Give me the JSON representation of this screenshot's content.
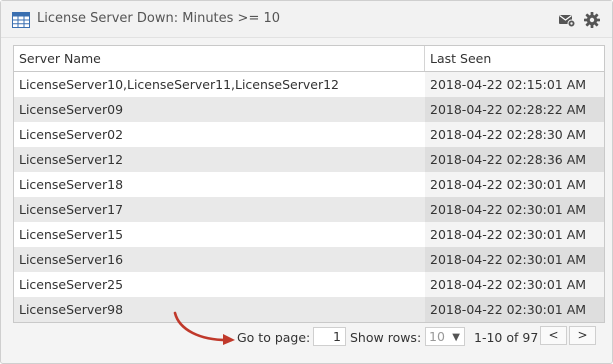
{
  "header": {
    "title": "License Server Down: Minutes >= 10",
    "icons": {
      "table": "table-icon",
      "mail": "envelope-settings-icon",
      "settings": "gear-icon"
    }
  },
  "table": {
    "columns": [
      "Server Name",
      "Last Seen"
    ],
    "rows": [
      {
        "name": "LicenseServer10,LicenseServer11,LicenseServer12",
        "last_seen": "2018-04-22 02:15:01 AM"
      },
      {
        "name": "LicenseServer09",
        "last_seen": "2018-04-22 02:28:22 AM"
      },
      {
        "name": "LicenseServer02",
        "last_seen": "2018-04-22 02:28:30 AM"
      },
      {
        "name": "LicenseServer12",
        "last_seen": "2018-04-22 02:28:36 AM"
      },
      {
        "name": "LicenseServer18",
        "last_seen": "2018-04-22 02:30:01 AM"
      },
      {
        "name": "LicenseServer17",
        "last_seen": "2018-04-22 02:30:01 AM"
      },
      {
        "name": "LicenseServer15",
        "last_seen": "2018-04-22 02:30:01 AM"
      },
      {
        "name": "LicenseServer16",
        "last_seen": "2018-04-22 02:30:01 AM"
      },
      {
        "name": "LicenseServer25",
        "last_seen": "2018-04-22 02:30:01 AM"
      },
      {
        "name": "LicenseServer98",
        "last_seen": "2018-04-22 02:30:01 AM"
      }
    ]
  },
  "pager": {
    "goto_label": "Go to page:",
    "page_value": "1",
    "show_rows_label": "Show rows:",
    "rows_value": "10",
    "range_label": "1-10 of 97",
    "prev": "<",
    "next": ">"
  },
  "colors": {
    "annotation_arrow": "#c0392b",
    "row_alt": "#e9e9e9",
    "header_bg": "#f2f2f2"
  }
}
